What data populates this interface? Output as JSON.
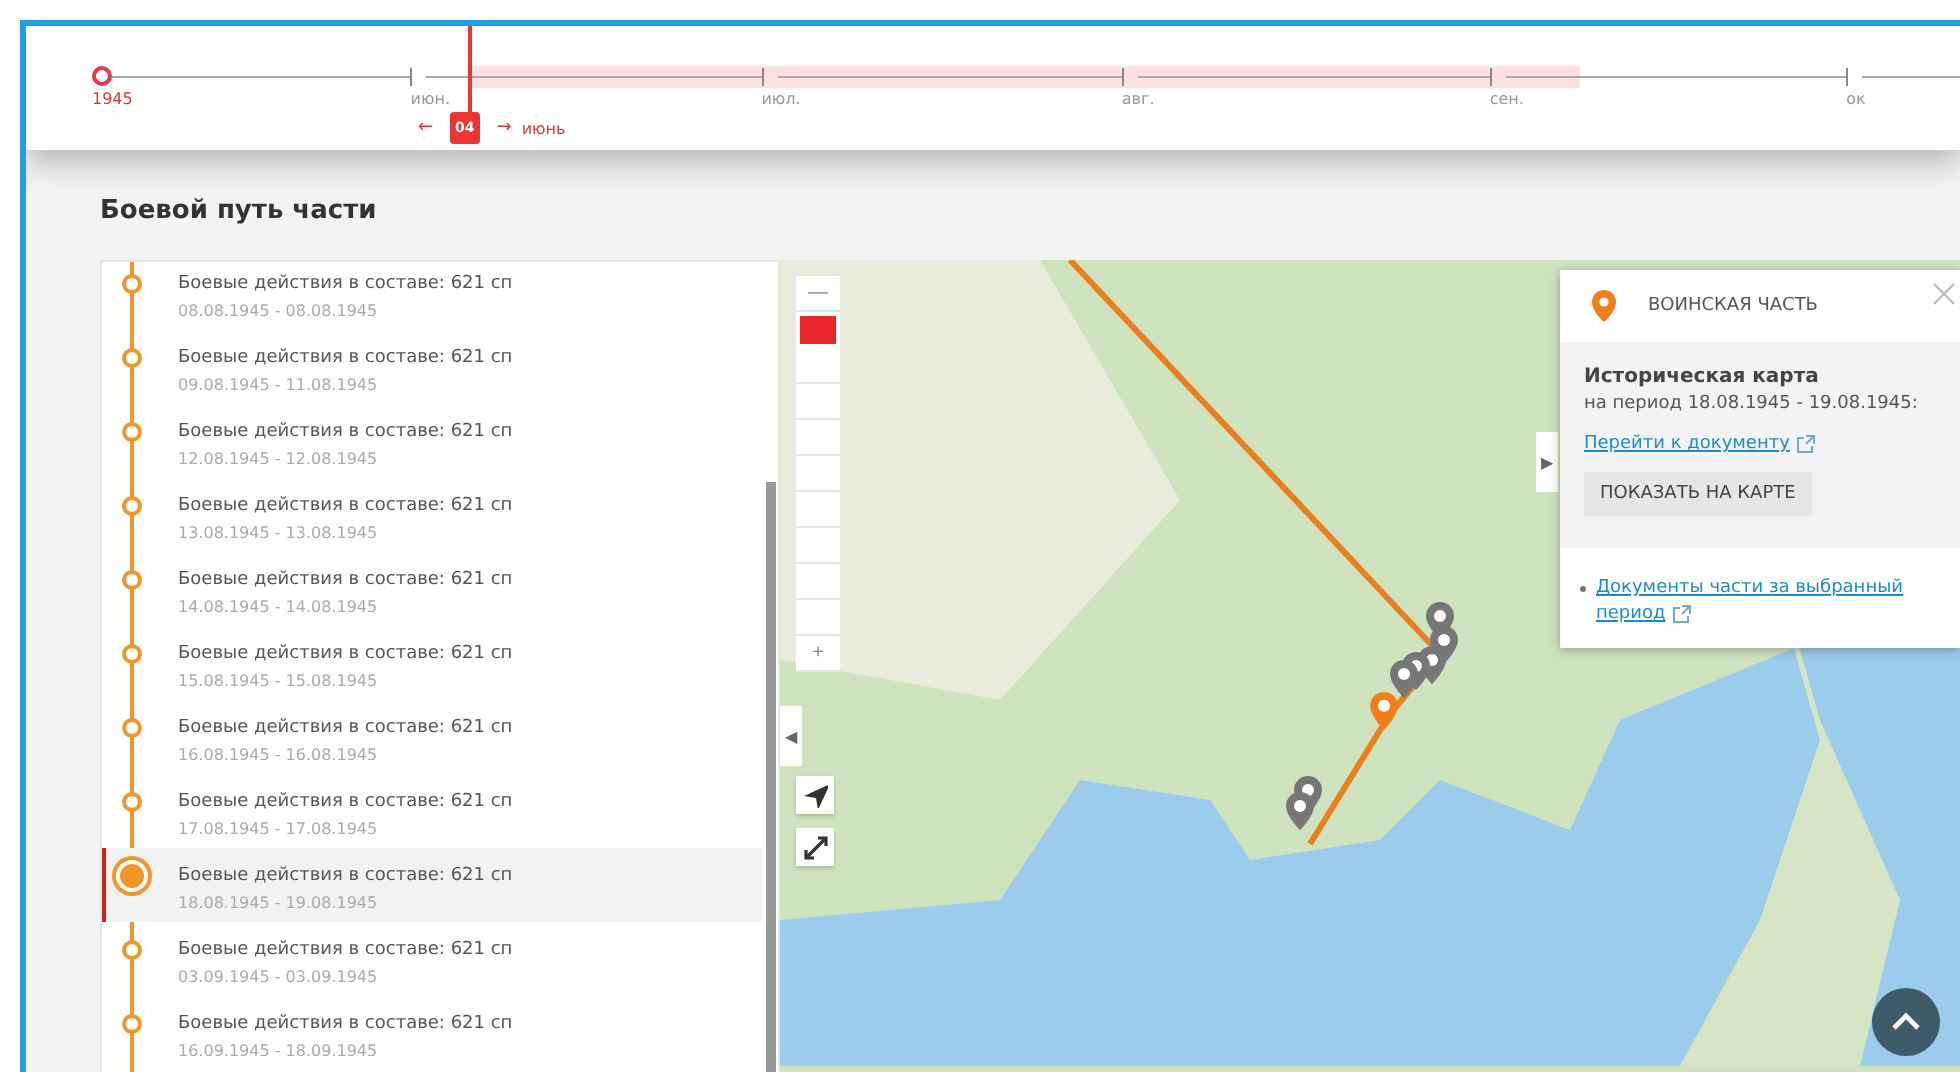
{
  "timeline": {
    "year": "1945",
    "months": [
      "июн.",
      "июл.",
      "авг.",
      "сен.",
      "ок"
    ],
    "cursor": {
      "day": "04",
      "month": "июнь",
      "prev_arrow": "←",
      "next_arrow": "→"
    }
  },
  "section_title": "Боевой путь части",
  "events": [
    {
      "title": "Боевые действия в составе: 621 сп",
      "dates": "08.08.1945 - 08.08.1945",
      "selected": false
    },
    {
      "title": "Боевые действия в составе: 621 сп",
      "dates": "09.08.1945 - 11.08.1945",
      "selected": false
    },
    {
      "title": "Боевые действия в составе: 621 сп",
      "dates": "12.08.1945 - 12.08.1945",
      "selected": false
    },
    {
      "title": "Боевые действия в составе: 621 сп",
      "dates": "13.08.1945 - 13.08.1945",
      "selected": false
    },
    {
      "title": "Боевые действия в составе: 621 сп",
      "dates": "14.08.1945 - 14.08.1945",
      "selected": false
    },
    {
      "title": "Боевые действия в составе: 621 сп",
      "dates": "15.08.1945 - 15.08.1945",
      "selected": false
    },
    {
      "title": "Боевые действия в составе: 621 сп",
      "dates": "16.08.1945 - 16.08.1945",
      "selected": false
    },
    {
      "title": "Боевые действия в составе: 621 сп",
      "dates": "17.08.1945 - 17.08.1945",
      "selected": false
    },
    {
      "title": "Боевые действия в составе: 621 сп",
      "dates": "18.08.1945 - 19.08.1945",
      "selected": true
    },
    {
      "title": "Боевые действия в составе: 621 сп",
      "dates": "03.09.1945 - 03.09.1945",
      "selected": false
    },
    {
      "title": "Боевые действия в составе: 621 сп",
      "dates": "16.09.1945 - 18.09.1945",
      "selected": false
    }
  ],
  "map": {
    "zoom_out": "—",
    "zoom_in": "+",
    "layers": [
      {
        "selected": true
      },
      {
        "selected": false
      },
      {
        "selected": false
      },
      {
        "selected": false
      },
      {
        "selected": false
      },
      {
        "selected": false
      },
      {
        "selected": false
      },
      {
        "selected": false
      },
      {
        "selected": false
      }
    ],
    "collapse_arrow": "◀",
    "expand_arrow": "▶"
  },
  "info_panel": {
    "title": "ВОИНСКАЯ ЧАСТЬ",
    "map_title": "Историческая карта",
    "period": "на период 18.08.1945 - 19.08.1945:",
    "document_link": "Перейти к документу",
    "show_button": "ПОКАЗАТЬ НА КАРТЕ",
    "unit_documents_link": "Документы части за выбранный период"
  }
}
